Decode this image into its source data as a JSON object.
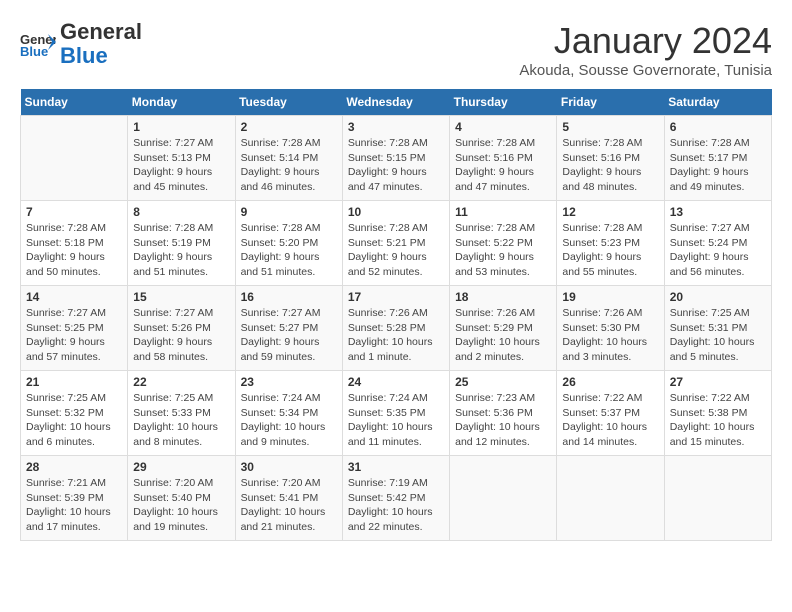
{
  "header": {
    "logo_line1": "General",
    "logo_line2": "Blue",
    "month": "January 2024",
    "location": "Akouda, Sousse Governorate, Tunisia"
  },
  "weekdays": [
    "Sunday",
    "Monday",
    "Tuesday",
    "Wednesday",
    "Thursday",
    "Friday",
    "Saturday"
  ],
  "weeks": [
    [
      {
        "day": "",
        "info": ""
      },
      {
        "day": "1",
        "info": "Sunrise: 7:27 AM\nSunset: 5:13 PM\nDaylight: 9 hours\nand 45 minutes."
      },
      {
        "day": "2",
        "info": "Sunrise: 7:28 AM\nSunset: 5:14 PM\nDaylight: 9 hours\nand 46 minutes."
      },
      {
        "day": "3",
        "info": "Sunrise: 7:28 AM\nSunset: 5:15 PM\nDaylight: 9 hours\nand 47 minutes."
      },
      {
        "day": "4",
        "info": "Sunrise: 7:28 AM\nSunset: 5:16 PM\nDaylight: 9 hours\nand 47 minutes."
      },
      {
        "day": "5",
        "info": "Sunrise: 7:28 AM\nSunset: 5:16 PM\nDaylight: 9 hours\nand 48 minutes."
      },
      {
        "day": "6",
        "info": "Sunrise: 7:28 AM\nSunset: 5:17 PM\nDaylight: 9 hours\nand 49 minutes."
      }
    ],
    [
      {
        "day": "7",
        "info": "Sunrise: 7:28 AM\nSunset: 5:18 PM\nDaylight: 9 hours\nand 50 minutes."
      },
      {
        "day": "8",
        "info": "Sunrise: 7:28 AM\nSunset: 5:19 PM\nDaylight: 9 hours\nand 51 minutes."
      },
      {
        "day": "9",
        "info": "Sunrise: 7:28 AM\nSunset: 5:20 PM\nDaylight: 9 hours\nand 51 minutes."
      },
      {
        "day": "10",
        "info": "Sunrise: 7:28 AM\nSunset: 5:21 PM\nDaylight: 9 hours\nand 52 minutes."
      },
      {
        "day": "11",
        "info": "Sunrise: 7:28 AM\nSunset: 5:22 PM\nDaylight: 9 hours\nand 53 minutes."
      },
      {
        "day": "12",
        "info": "Sunrise: 7:28 AM\nSunset: 5:23 PM\nDaylight: 9 hours\nand 55 minutes."
      },
      {
        "day": "13",
        "info": "Sunrise: 7:27 AM\nSunset: 5:24 PM\nDaylight: 9 hours\nand 56 minutes."
      }
    ],
    [
      {
        "day": "14",
        "info": "Sunrise: 7:27 AM\nSunset: 5:25 PM\nDaylight: 9 hours\nand 57 minutes."
      },
      {
        "day": "15",
        "info": "Sunrise: 7:27 AM\nSunset: 5:26 PM\nDaylight: 9 hours\nand 58 minutes."
      },
      {
        "day": "16",
        "info": "Sunrise: 7:27 AM\nSunset: 5:27 PM\nDaylight: 9 hours\nand 59 minutes."
      },
      {
        "day": "17",
        "info": "Sunrise: 7:26 AM\nSunset: 5:28 PM\nDaylight: 10 hours\nand 1 minute."
      },
      {
        "day": "18",
        "info": "Sunrise: 7:26 AM\nSunset: 5:29 PM\nDaylight: 10 hours\nand 2 minutes."
      },
      {
        "day": "19",
        "info": "Sunrise: 7:26 AM\nSunset: 5:30 PM\nDaylight: 10 hours\nand 3 minutes."
      },
      {
        "day": "20",
        "info": "Sunrise: 7:25 AM\nSunset: 5:31 PM\nDaylight: 10 hours\nand 5 minutes."
      }
    ],
    [
      {
        "day": "21",
        "info": "Sunrise: 7:25 AM\nSunset: 5:32 PM\nDaylight: 10 hours\nand 6 minutes."
      },
      {
        "day": "22",
        "info": "Sunrise: 7:25 AM\nSunset: 5:33 PM\nDaylight: 10 hours\nand 8 minutes."
      },
      {
        "day": "23",
        "info": "Sunrise: 7:24 AM\nSunset: 5:34 PM\nDaylight: 10 hours\nand 9 minutes."
      },
      {
        "day": "24",
        "info": "Sunrise: 7:24 AM\nSunset: 5:35 PM\nDaylight: 10 hours\nand 11 minutes."
      },
      {
        "day": "25",
        "info": "Sunrise: 7:23 AM\nSunset: 5:36 PM\nDaylight: 10 hours\nand 12 minutes."
      },
      {
        "day": "26",
        "info": "Sunrise: 7:22 AM\nSunset: 5:37 PM\nDaylight: 10 hours\nand 14 minutes."
      },
      {
        "day": "27",
        "info": "Sunrise: 7:22 AM\nSunset: 5:38 PM\nDaylight: 10 hours\nand 15 minutes."
      }
    ],
    [
      {
        "day": "28",
        "info": "Sunrise: 7:21 AM\nSunset: 5:39 PM\nDaylight: 10 hours\nand 17 minutes."
      },
      {
        "day": "29",
        "info": "Sunrise: 7:20 AM\nSunset: 5:40 PM\nDaylight: 10 hours\nand 19 minutes."
      },
      {
        "day": "30",
        "info": "Sunrise: 7:20 AM\nSunset: 5:41 PM\nDaylight: 10 hours\nand 21 minutes."
      },
      {
        "day": "31",
        "info": "Sunrise: 7:19 AM\nSunset: 5:42 PM\nDaylight: 10 hours\nand 22 minutes."
      },
      {
        "day": "",
        "info": ""
      },
      {
        "day": "",
        "info": ""
      },
      {
        "day": "",
        "info": ""
      }
    ]
  ]
}
